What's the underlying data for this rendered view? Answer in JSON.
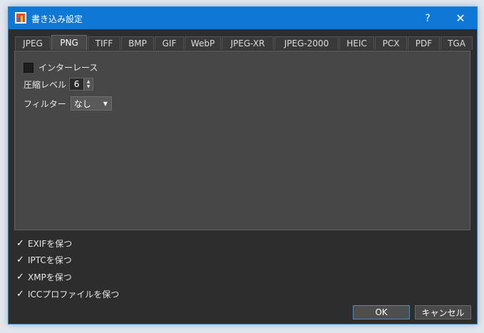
{
  "window": {
    "title": "書き込み設定",
    "help_label": "?",
    "close_label": "✕"
  },
  "tabs": [
    {
      "label": "JPEG",
      "active": false
    },
    {
      "label": "PNG",
      "active": true
    },
    {
      "label": "TIFF",
      "active": false
    },
    {
      "label": "BMP",
      "active": false
    },
    {
      "label": "GIF",
      "active": false
    },
    {
      "label": "WebP",
      "active": false
    },
    {
      "label": "JPEG-XR",
      "active": false
    },
    {
      "label": "JPEG-2000",
      "active": false
    },
    {
      "label": "HEIC",
      "active": false
    },
    {
      "label": "PCX",
      "active": false
    },
    {
      "label": "PDF",
      "active": false
    },
    {
      "label": "TGA",
      "active": false
    }
  ],
  "png": {
    "interlace_label": "インターレース",
    "interlace_checked": false,
    "compression_label": "圧縮レベル",
    "compression_value": "6",
    "filter_label": "フィルター",
    "filter_value": "なし"
  },
  "metadata": {
    "exif_label": "EXIFを保つ",
    "iptc_label": "IPTCを保つ",
    "xmp_label": "XMPを保つ",
    "icc_label": "ICCプロファイルを保つ",
    "checkmark": "✓"
  },
  "buttons": {
    "ok_label": "OK",
    "cancel_label": "キャンセル"
  }
}
